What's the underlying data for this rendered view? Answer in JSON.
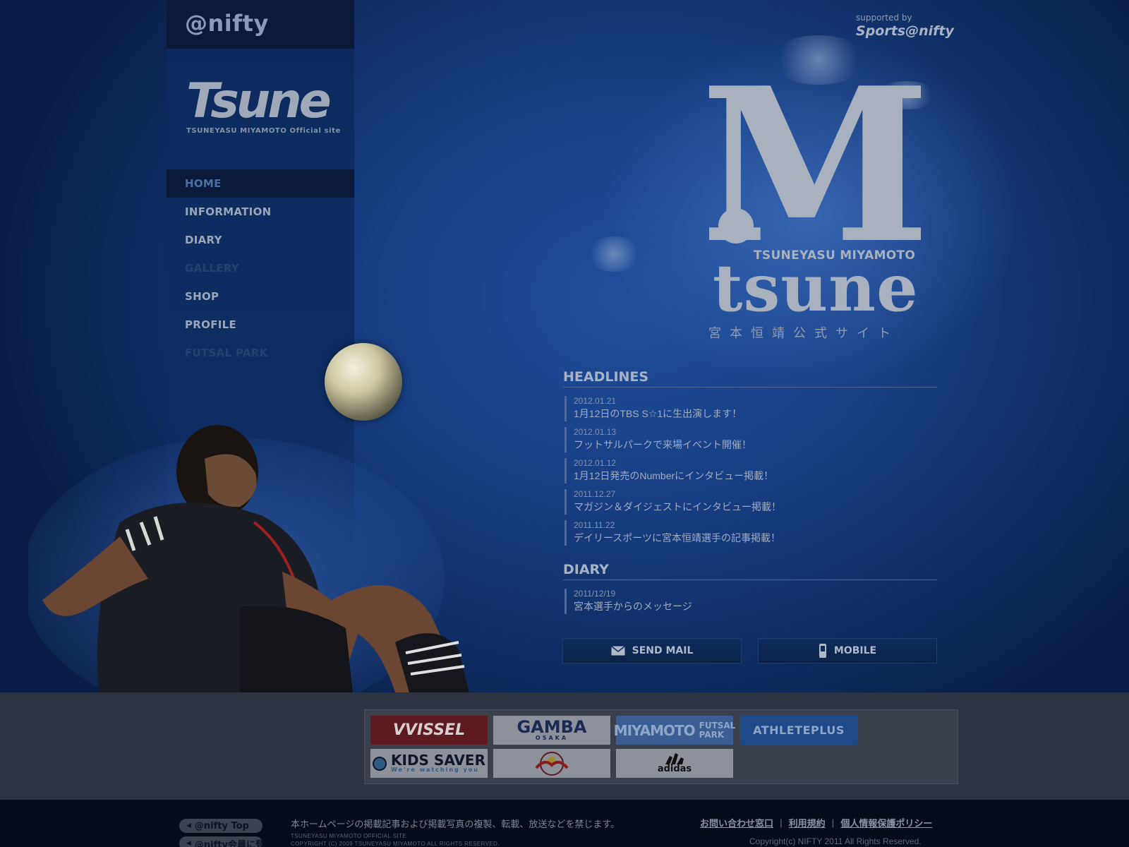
{
  "header": {
    "nifty_logo": "@nifty",
    "site_logo": "Tsune",
    "site_tagline": "TSUNEYASU MIYAMOTO Official site",
    "supported_label": "supported by",
    "supported_brand": "Sports@nifty"
  },
  "nav": {
    "items": [
      {
        "label": "HOME",
        "state": "active"
      },
      {
        "label": "INFORMATION",
        "state": "normal"
      },
      {
        "label": "DIARY",
        "state": "normal"
      },
      {
        "label": "GALLERY",
        "state": "disabled"
      },
      {
        "label": "SHOP",
        "state": "normal"
      },
      {
        "label": "PROFILE",
        "state": "normal"
      },
      {
        "label": "FUTSAL PARK",
        "state": "disabled"
      }
    ]
  },
  "brand": {
    "monogram": "M",
    "name": "TSUNEYASU MIYAMOTO",
    "word": "tsune",
    "jp": "宮本恒靖公式サイト"
  },
  "headlines": {
    "title": "HEADLINES",
    "items": [
      {
        "date": "2012.01.21",
        "text": "1月12日のTBS S☆1に生出演します！"
      },
      {
        "date": "2012.01.13",
        "text": "フットサルパークで来場イベント開催！"
      },
      {
        "date": "2012.01.12",
        "text": "1月12日発売のNumberにインタビュー掲載！"
      },
      {
        "date": "2011.12.27",
        "text": "マガジン＆ダイジェストにインタビュー掲載！"
      },
      {
        "date": "2011.11.22",
        "text": "デイリースポーツに宮本恒靖選手の記事掲載！"
      }
    ]
  },
  "diary": {
    "title": "DIARY",
    "items": [
      {
        "date": "2011/12/19",
        "text": "宮本選手からのメッセージ"
      }
    ]
  },
  "buttons": {
    "send_mail": "SEND MAIL",
    "mobile": "MOBILE"
  },
  "sponsors": {
    "vissel": "VVISSEL",
    "gamba": "GAMBA",
    "gamba_sub": "OSAKA",
    "miyamoto_futsal": "MIYAMOTO",
    "miyamoto_futsal_sub1": "FUTSAL",
    "miyamoto_futsal_sub2": "PARK",
    "athleteplus": "ATHLETEPLUS",
    "kids_saver": "KIDS SAVER",
    "kids_saver_sub": "We're watching you",
    "adidas": "adidas"
  },
  "footer": {
    "nifty_top": "@nifty Top",
    "nifty_register": "@nifty会員に登録",
    "notice": "本ホームページの掲載記事および掲載写真の複製、転載、放送などを禁じます。",
    "site_small_1": "TSUNEYASU MIYAMOTO OFFICIAL SITE",
    "site_small_2": "COPYRIGHT (C) 2009 TSUNEYASU MIYAMOTO ALL RIGHTS RESERVED.",
    "links": [
      "お問い合わせ窓口",
      "利用規約",
      "個人情報保護ポリシー"
    ],
    "nifty_copyright": "Copyright(c) NIFTY 2011 All Rights Reserved."
  },
  "colors": {
    "sky": "#173f84",
    "sidebar": "#0e2d63",
    "nav_active_bg": "#0a1a38",
    "vissel_red": "#8b1a1f",
    "athleteplus_blue": "#1f4a8a",
    "footer_bg": "#050b18"
  },
  "icons": {
    "send_mail": "envelope-icon",
    "mobile": "mobile-phone-icon",
    "pill": "triangle-left-icon"
  }
}
